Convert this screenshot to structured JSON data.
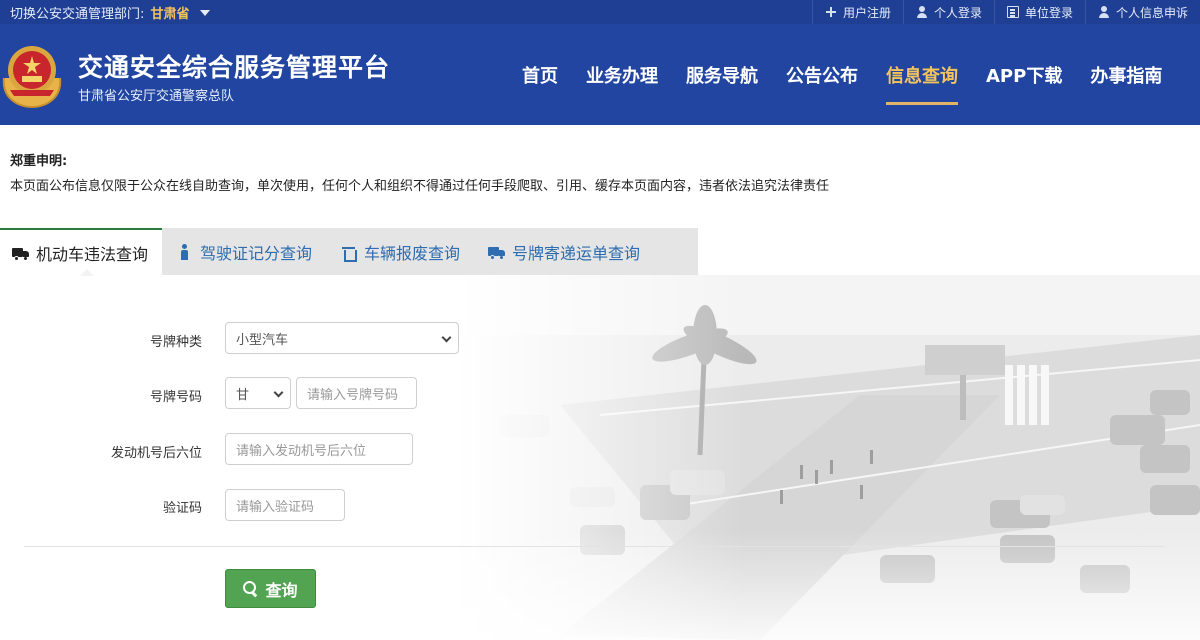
{
  "topbar": {
    "region_prefix": "切换公安交通管理部门:",
    "region_value": "甘肃省",
    "links": [
      {
        "label": "用户注册",
        "icon": "plus-icon"
      },
      {
        "label": "个人登录",
        "icon": "user-icon"
      },
      {
        "label": "单位登录",
        "icon": "building-icon"
      },
      {
        "label": "个人信息申诉",
        "icon": "user-icon"
      }
    ]
  },
  "header": {
    "title": "交通安全综合服务管理平台",
    "subtitle": "甘肃省公安厅交通警察总队",
    "nav": [
      "首页",
      "业务办理",
      "服务导航",
      "公告公布",
      "信息查询",
      "APP下载",
      "办事指南"
    ],
    "active_nav": "信息查询"
  },
  "declaration": {
    "title": "郑重申明:",
    "text": "本页面公布信息仅限于公众在线自助查询，单次使用，任何个人和组织不得通过任何手段爬取、引用、缓存本页面内容，违者依法追究法律责任"
  },
  "tabs": [
    {
      "label": "机动车违法查询",
      "icon": "truck-icon",
      "active": true
    },
    {
      "label": "驾驶证记分查询",
      "icon": "person-icon",
      "active": false
    },
    {
      "label": "车辆报废查询",
      "icon": "trash-icon",
      "active": false
    },
    {
      "label": "号牌寄递运单查询",
      "icon": "truck-icon",
      "active": false
    }
  ],
  "form": {
    "plate_type": {
      "label": "号牌种类",
      "value": "小型汽车"
    },
    "plate_number": {
      "label": "号牌号码",
      "prefix_value": "甘",
      "placeholder": "请输入号牌号码"
    },
    "engine": {
      "label": "发动机号后六位",
      "placeholder": "请输入发动机号后六位"
    },
    "captcha": {
      "label": "验证码",
      "placeholder": "请输入验证码"
    },
    "submit_label": "查询"
  },
  "colors": {
    "brand_blue": "#2145a0",
    "accent_gold": "#f3c45e",
    "button_green": "#52a352"
  }
}
